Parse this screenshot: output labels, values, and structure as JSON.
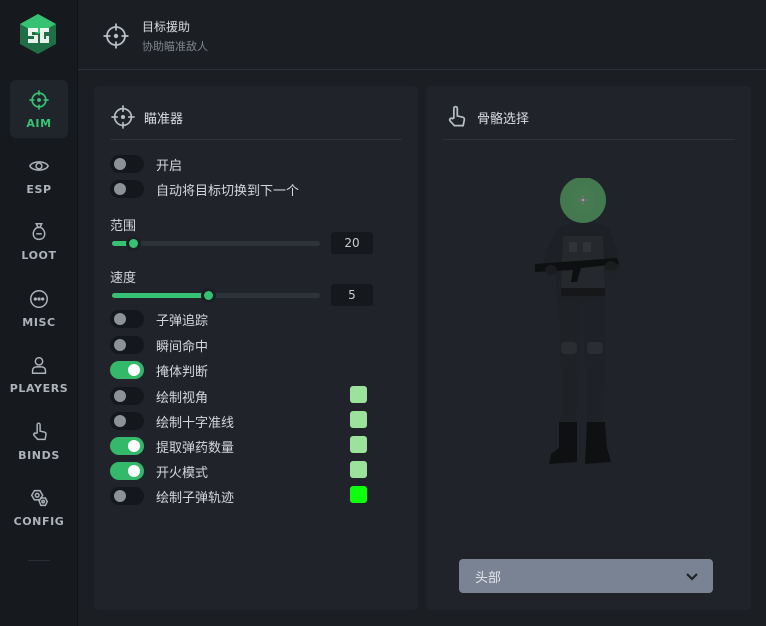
{
  "sidebar": {
    "items": [
      {
        "label": "AIM",
        "icon": "crosshair-icon",
        "active": true
      },
      {
        "label": "ESP",
        "icon": "eye-icon"
      },
      {
        "label": "LOOT",
        "icon": "bag-icon"
      },
      {
        "label": "MISC",
        "icon": "dots-circle-icon"
      },
      {
        "label": "PLAYERS",
        "icon": "user-icon"
      },
      {
        "label": "BINDS",
        "icon": "pointer-hand-icon"
      },
      {
        "label": "CONFIG",
        "icon": "settings-icon"
      }
    ]
  },
  "header": {
    "title": "目标援助",
    "subtitle": "协助瞄准敌人"
  },
  "aim_panel": {
    "title": "瞄准器",
    "toggles_top": [
      {
        "label": "开启",
        "on": false
      },
      {
        "label": "自动将目标切换到下一个",
        "on": false
      }
    ],
    "sliders": [
      {
        "label": "范围",
        "value": "20",
        "fraction": 0.1
      },
      {
        "label": "速度",
        "value": "5",
        "fraction": 0.46
      }
    ],
    "toggles_bottom": [
      {
        "label": "子弹追踪",
        "on": false
      },
      {
        "label": "瞬间命中",
        "on": false
      },
      {
        "label": "掩体判断",
        "on": true
      },
      {
        "label": "绘制视角",
        "on": false,
        "color": "#9be39b"
      },
      {
        "label": "绘制十字准线",
        "on": false,
        "color": "#9be39b"
      },
      {
        "label": "提取弹药数量",
        "on": true,
        "color": "#9be39b"
      },
      {
        "label": "开火模式",
        "on": true,
        "color": "#9be39b"
      },
      {
        "label": "绘制子弹轨迹",
        "on": false,
        "color": "#0dff0d"
      }
    ]
  },
  "bone_panel": {
    "title": "骨骼选择",
    "icon": "pointer-hand-icon",
    "selected_bone": "head",
    "dropdown_value": "头部"
  },
  "colors": {
    "accent": "#36c273",
    "panel": "#20242a",
    "background": "#1b1e23"
  }
}
